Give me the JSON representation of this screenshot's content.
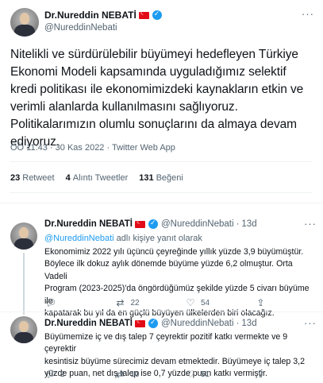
{
  "main": {
    "name": "Dr.Nureddin NEBATİ",
    "handle": "@NureddinNebati",
    "text_lines": [
      "Nitelikli ve sürdürülebilir büyümeyi hedefleyen Türkiye",
      "Ekonomi Modeli kapsamında uyguladığımız selektif",
      "kredi politikası ile ekonomimizdeki kaynakların etkin ve",
      "verimli alanlarda kullanılmasını sağlıyoruz.",
      "Politikalarımızın olumlu sonuçlarını da almaya devam",
      "ediyoruz."
    ],
    "meta": "ÖÖ 11:43 · 30 Kas 2022 · Twitter Web App",
    "stats": {
      "retweets_count": "23",
      "retweets_label": "Retweet",
      "quotes_count": "4",
      "quotes_label": "Alıntı Tweetler",
      "likes_count": "131",
      "likes_label": "Beğeni"
    }
  },
  "replies": [
    {
      "name": "Dr.Nureddin NEBATİ",
      "handle": "@NureddinNebati",
      "time": "13d",
      "reply_to_mention": "@NureddinNebati",
      "reply_to_suffix": " adlı kişiye yanıt olarak",
      "text_lines": [
        "Ekonomimiz 2022 yılı üçüncü çeyreğinde yıllık yüzde 3,9 büyümüştür.",
        "Böylece ilk dokuz aylık dönemde büyüme yüzde 6,2 olmuştur. Orta Vadeli",
        "Program (2023-2025)'da öngördüğümüz şekilde yüzde 5 civarı büyüme ile",
        "kapatarak bu yıl da en güçlü büyüyen ülkelerden biri olacağız."
      ],
      "replies_count": "",
      "retweets_count": "22",
      "likes_count": "54"
    },
    {
      "name": "Dr.Nureddin NEBATİ",
      "handle": "@NureddinNebati",
      "time": "13d",
      "text_lines": [
        "Büyümemize iç ve dış talep 7 çeyrektir pozitif katkı vermekte ve 9 çeyrektir",
        "kesintisiz büyüme sürecimiz devam etmektedir. Büyümeye iç talep 3,2",
        "yüzde puan, net dış talep ise 0,7 yüzde puan katkı vermiştir."
      ],
      "replies_count": "2",
      "retweets_count": "10",
      "likes_count": "51"
    }
  ],
  "icons": {
    "reply": "reply-icon",
    "retweet": "retweet-icon",
    "like": "heart-icon",
    "share": "share-icon",
    "more": "more-icon",
    "verified": "verified-icon",
    "flag": "turkey-flag-icon"
  },
  "colors": {
    "accent": "#1d9bf0",
    "text": "#0f1419",
    "secondary": "#536471",
    "border": "#eff3f4"
  }
}
